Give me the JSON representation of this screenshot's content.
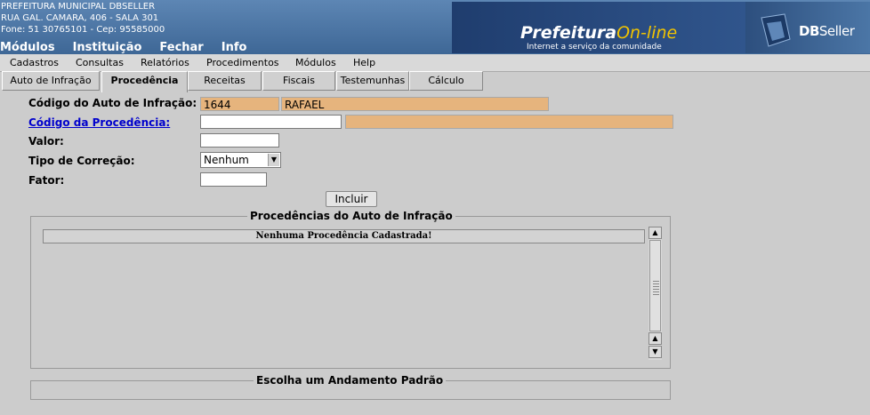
{
  "header": {
    "org_name": "PREFEITURA MUNICIPAL DBSELLER",
    "address": "RUA GAL. CAMARA, 406 - SALA 301",
    "contact": "Fone: 51 30765101  -  Cep: 95585000",
    "main_menu": [
      "Módulos",
      "Instituição",
      "Fechar",
      "Info"
    ],
    "banner_title_a": "Prefeitura",
    "banner_title_b": "On-line",
    "banner_sub": "Internet a serviço da comunidade",
    "logo_db": "DB",
    "logo_seller": "Seller"
  },
  "menubar": [
    "Cadastros",
    "Consultas",
    "Relatórios",
    "Procedimentos",
    "Módulos",
    "Help"
  ],
  "tabs": [
    "Auto de Infração",
    "Procedência",
    "Receitas",
    "Fiscais",
    "Testemunhas",
    "Cálculo"
  ],
  "form": {
    "auto_label": "Código do Auto de Infração:",
    "auto_code": "1644",
    "auto_name": "RAFAEL",
    "procedencia_label": "Código da Procedência:",
    "procedencia_code": "",
    "procedencia_desc": "",
    "valor_label": "Valor:",
    "valor": "",
    "correcao_label": "Tipo de Correção:",
    "correcao_selected": "Nenhum",
    "fator_label": "Fator:",
    "fator": "",
    "incluir_label": "Incluir"
  },
  "grid": {
    "legend": "Procedências do Auto de Infração",
    "empty_message": "Nenhuma Procedência Cadastrada!"
  },
  "andamento": {
    "legend": "Escolha um Andamento Padrão"
  },
  "colors": {
    "readonly_field": "#e6b47d",
    "link": "#0000cc",
    "header_blue": "#4a73a1"
  }
}
